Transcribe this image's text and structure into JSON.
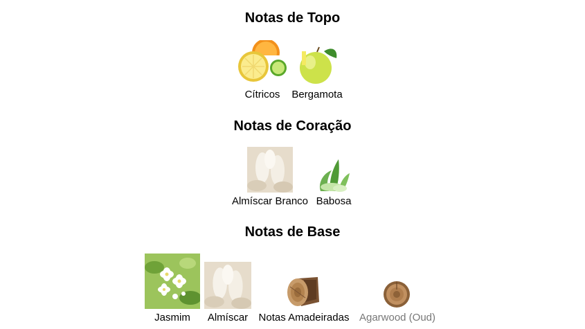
{
  "sections": [
    {
      "title": "Notas de Topo",
      "notes": [
        {
          "label": "Cítricos",
          "icon": "citrus-fruit-icon"
        },
        {
          "label": "Bergamota",
          "icon": "bergamot-fruit-icon"
        }
      ]
    },
    {
      "title": "Notas de Coração",
      "notes": [
        {
          "label": "Almíscar Branco",
          "icon": "white-musk-icon"
        },
        {
          "label": "Babosa",
          "icon": "aloe-vera-icon"
        }
      ]
    },
    {
      "title": "Notas de Base",
      "notes": [
        {
          "label": "Jasmim",
          "icon": "jasmine-flower-icon"
        },
        {
          "label": "Almíscar",
          "icon": "musk-icon"
        },
        {
          "label": "Notas Amadeiradas",
          "icon": "wood-log-icon"
        },
        {
          "label": "Agarwood (Oud)",
          "icon": "agarwood-slice-icon"
        }
      ]
    }
  ]
}
